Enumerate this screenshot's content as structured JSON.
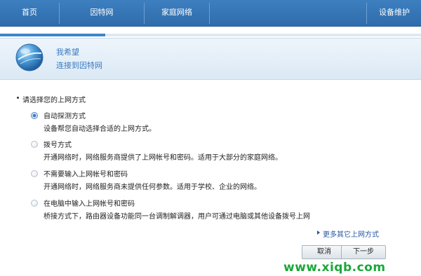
{
  "nav": {
    "items": [
      {
        "label": "首页"
      },
      {
        "label": "因特网"
      },
      {
        "label": "家庭网络"
      },
      {
        "label": "设备维护"
      }
    ]
  },
  "progress": {
    "fraction": 0.25
  },
  "header": {
    "icon": "globe-icon",
    "title": "我希望",
    "subtitle": "连接到因特网"
  },
  "question": "请选择您的上网方式",
  "options": [
    {
      "title": "自动探测方式",
      "desc": "设备帮您自动选择合适的上网方式。",
      "checked": true
    },
    {
      "title": "拨号方式",
      "desc": "开通网络时，网络服务商提供了上网帐号和密码。适用于大部分的家庭网络。",
      "checked": false
    },
    {
      "title": "不需要输入上网帐号和密码",
      "desc": "开通网络时，网络服务商未提供任何参数。适用于学校、企业的网络。",
      "checked": false
    },
    {
      "title": "在电脑中输入上网帐号和密码",
      "desc": "桥接方式下，路由器设备功能同一台调制解调器，用户可通过电脑或其他设备拨号上网",
      "checked": false
    }
  ],
  "more_link": "更多其它上网方式",
  "buttons": {
    "cancel": "取消",
    "next": "下一步"
  },
  "watermark": "www.xiqb.com",
  "colors": {
    "nav_bg": "#2f6cab",
    "accent": "#3a7bbf",
    "watermark": "#1aa83a"
  }
}
